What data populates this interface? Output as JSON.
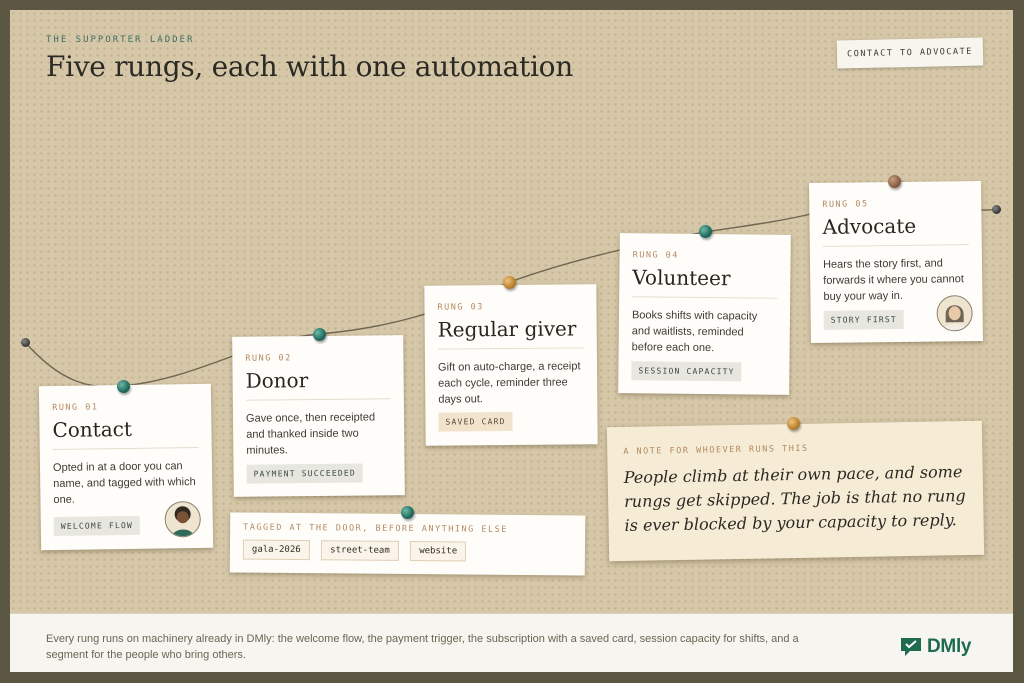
{
  "header": {
    "eyebrow": "THE SUPPORTER LADDER",
    "title": "Five rungs, each with one automation",
    "chip": "CONTACT TO ADVOCATE"
  },
  "rungs": [
    {
      "number": "RUNG 01",
      "name": "Contact",
      "desc": "Opted in at a door you can name, and tagged with which one.",
      "tag": "WELCOME FLOW",
      "pin_color": "teal",
      "avatar": "person-avatar"
    },
    {
      "number": "RUNG 02",
      "name": "Donor",
      "desc": "Gave once, then receipted and thanked inside two minutes.",
      "tag": "PAYMENT SUCCEEDED",
      "pin_color": "teal"
    },
    {
      "number": "RUNG 03",
      "name": "Regular giver",
      "desc": "Gift on auto-charge, a receipt each cycle, reminder three days out.",
      "tag": "SAVED CARD",
      "pin_color": "gold"
    },
    {
      "number": "RUNG 04",
      "name": "Volunteer",
      "desc": "Books shifts with capacity and waitlists, reminded before each one.",
      "tag": "SESSION CAPACITY",
      "pin_color": "teal"
    },
    {
      "number": "RUNG 05",
      "name": "Advocate",
      "desc": "Hears the story first, and forwards it where you cannot buy your way in.",
      "tag": "STORY FIRST",
      "pin_color": "brown",
      "avatar": "person-avatar"
    }
  ],
  "tagged": {
    "label": "TAGGED AT THE DOOR, BEFORE ANYTHING ELSE",
    "tags": [
      "gala-2026",
      "street-team",
      "website"
    ]
  },
  "note": {
    "label": "A NOTE FOR WHOEVER RUNS THIS",
    "quote": "People climb at their own pace, and some rungs get skipped. The job is that no rung is ever blocked by your capacity to reply."
  },
  "footer": {
    "text": "Every rung runs on machinery already in DMly: the welcome flow, the payment trigger, the subscription with a saved card, session capacity for shifts, and a segment for the people who bring others.",
    "brand": "DMly"
  },
  "colors": {
    "accent_teal": "#1e6b5d",
    "accent_gold": "#b8822f",
    "background": "#d5c7a7",
    "card": "#fffdf9",
    "note": "#f6ecd6"
  }
}
